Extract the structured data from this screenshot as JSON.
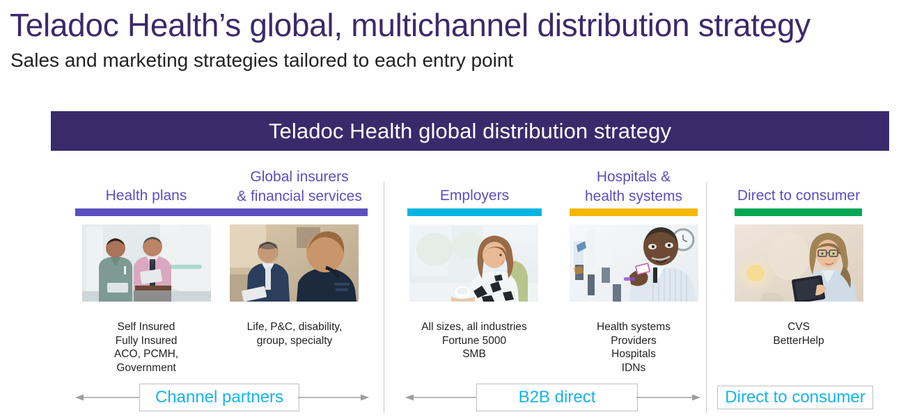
{
  "slide": {
    "title": "Teladoc Health’s global, multichannel distribution strategy",
    "subtitle": "Sales and marketing strategies tailored to each entry point",
    "banner_title": "Teladoc Health global distribution strategy"
  },
  "colors": {
    "brand_purple_dark": "#3B2A6B",
    "brand_purple": "#5A4FBE",
    "accent_cyan": "#00B5E2",
    "accent_amber": "#F5B800",
    "accent_green": "#00A651",
    "label_cyan": "#16B4EA",
    "divider_gray": "#c9c9c9",
    "arrow_gray": "#9e9e9e",
    "box_border": "#bfbfbf",
    "body_text": "#222222"
  },
  "columns": [
    {
      "id": "health-plans",
      "header": "Health plans",
      "accent_color": "#5A4FBE",
      "photo_name": "photo-clinician-and-manager",
      "caption": "Self Insured\nFully Insured\nACO, PCMH,\nGovernment"
    },
    {
      "id": "global-insurers",
      "header": "Global insurers\n& financial services",
      "accent_color": "#5A4FBE",
      "photo_name": "photo-two-businessmen-meeting",
      "caption": "Life, P&C, disability,\ngroup, specialty"
    },
    {
      "id": "employers",
      "header": "Employers",
      "accent_color": "#00B5E2",
      "photo_name": "photo-woman-with-coffee",
      "caption": "All sizes, all industries\nFortune 5000\nSMB"
    },
    {
      "id": "hospitals",
      "header": "Hospitals &\nhealth systems",
      "accent_color": "#F5B800",
      "photo_name": "photo-doctor-in-lab",
      "caption": "Health systems\nProviders\nHospitals\nIDNs"
    },
    {
      "id": "direct-to-consumer",
      "header": "Direct to consumer",
      "accent_color": "#00A651",
      "photo_name": "photo-woman-with-tablet",
      "caption": "CVS\nBetterHelp"
    }
  ],
  "channels": [
    {
      "id": "channel-partners",
      "label": "Channel partners",
      "has_arrows": true
    },
    {
      "id": "b2b-direct",
      "label": "B2B direct",
      "has_arrows": true
    },
    {
      "id": "direct-to-consumer-channel",
      "label": "Direct to consumer",
      "has_arrows": false
    }
  ]
}
